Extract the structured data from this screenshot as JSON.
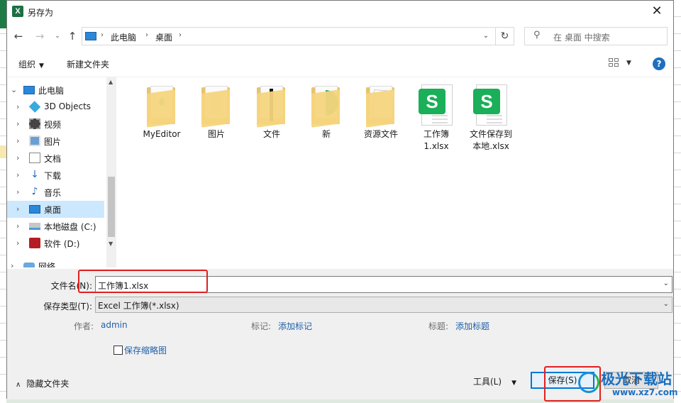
{
  "window": {
    "title": "另存为",
    "app_icon": "X",
    "close": "✕"
  },
  "nav": {
    "back": "←",
    "forward": "→",
    "recent": "⌄",
    "up": "↑",
    "breadcrumbs": [
      "此电脑",
      "桌面"
    ],
    "search_placeholder": "在 桌面 中搜索"
  },
  "toolbar": {
    "organize": "组织",
    "new_folder": "新建文件夹",
    "help": "?"
  },
  "tree": [
    {
      "label": "此电脑",
      "icon": "pc-icon",
      "expanded": true
    },
    {
      "label": "3D Objects",
      "icon": "cube-icon"
    },
    {
      "label": "视频",
      "icon": "video-icon"
    },
    {
      "label": "图片",
      "icon": "pictures-icon"
    },
    {
      "label": "文档",
      "icon": "document-icon"
    },
    {
      "label": "下载",
      "icon": "download-icon"
    },
    {
      "label": "音乐",
      "icon": "music-icon"
    },
    {
      "label": "桌面",
      "icon": "desktop-icon",
      "selected": true
    },
    {
      "label": "本地磁盘 (C:)",
      "icon": "drive-icon"
    },
    {
      "label": "软件 (D:)",
      "icon": "drive-d-icon"
    },
    {
      "label": "网络",
      "icon": "network-icon"
    }
  ],
  "files": [
    {
      "name": "MyEditor",
      "type": "folder"
    },
    {
      "name": "图片",
      "type": "folder"
    },
    {
      "name": "文件",
      "type": "folder"
    },
    {
      "name": "新",
      "type": "folder"
    },
    {
      "name": "资源文件",
      "type": "folder"
    },
    {
      "name": "工作簿1.xlsx",
      "type": "spreadsheet"
    },
    {
      "name": "文件保存到本地.xlsx",
      "type": "spreadsheet"
    }
  ],
  "form": {
    "filename_label": "文件名(N):",
    "filename_value": "工作簿1.xlsx",
    "filetype_label": "保存类型(T):",
    "filetype_value": "Excel 工作簿(*.xlsx)",
    "author_label": "作者:",
    "author_value": "admin",
    "tags_label": "标记:",
    "tags_value": "添加标记",
    "title_label": "标题:",
    "title_value": "添加标题",
    "thumbnail_label": "保存缩略图",
    "hide_folders": "隐藏文件夹",
    "tools": "工具(L)",
    "save": "保存(S)",
    "cancel": "取消"
  },
  "watermark": {
    "title": "极光下载站",
    "url": "www.xz7.com"
  },
  "colors": {
    "accent": "#0078d7",
    "selection": "#cce8ff",
    "highlight": "#e02020",
    "excel_green": "#1aaf58"
  }
}
